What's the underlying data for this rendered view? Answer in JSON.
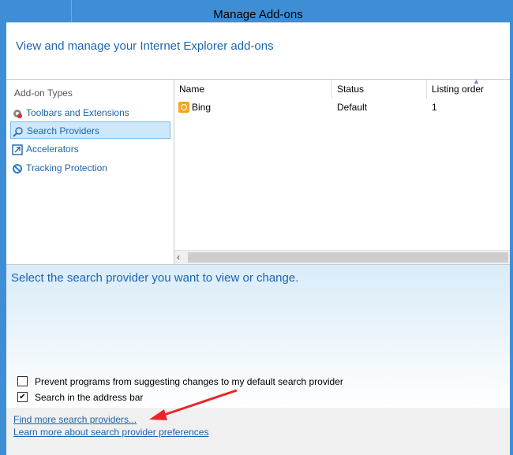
{
  "window": {
    "title": "Manage Add-ons"
  },
  "header": {
    "heading": "View and manage your Internet Explorer add-ons"
  },
  "addon_types": {
    "label": "Add-on Types",
    "items": [
      {
        "label": "Toolbars and Extensions",
        "icon": "gear-icon",
        "selected": false
      },
      {
        "label": "Search Providers",
        "icon": "search-icon",
        "selected": true
      },
      {
        "label": "Accelerators",
        "icon": "accelerator-icon",
        "selected": false
      },
      {
        "label": "Tracking Protection",
        "icon": "no-entry-icon",
        "selected": false
      }
    ]
  },
  "list": {
    "columns": [
      "Name",
      "Status",
      "Listing order"
    ],
    "rows": [
      {
        "name": "Bing",
        "status": "Default",
        "listing_order": "1",
        "icon": "bing-icon"
      }
    ]
  },
  "detail": {
    "prompt": "Select the search provider you want to view or change.",
    "options": [
      {
        "label": "Prevent programs from suggesting changes to my default search provider",
        "checked": false
      },
      {
        "label": "Search in the address bar",
        "checked": true
      }
    ]
  },
  "footer": {
    "links": [
      "Find more search providers...",
      "Learn more about search provider preferences"
    ]
  },
  "colors": {
    "accent": "#3e8ed6",
    "link": "#1e64ad",
    "selection": "#cde8fb",
    "annotation_arrow": "#e8262a"
  }
}
